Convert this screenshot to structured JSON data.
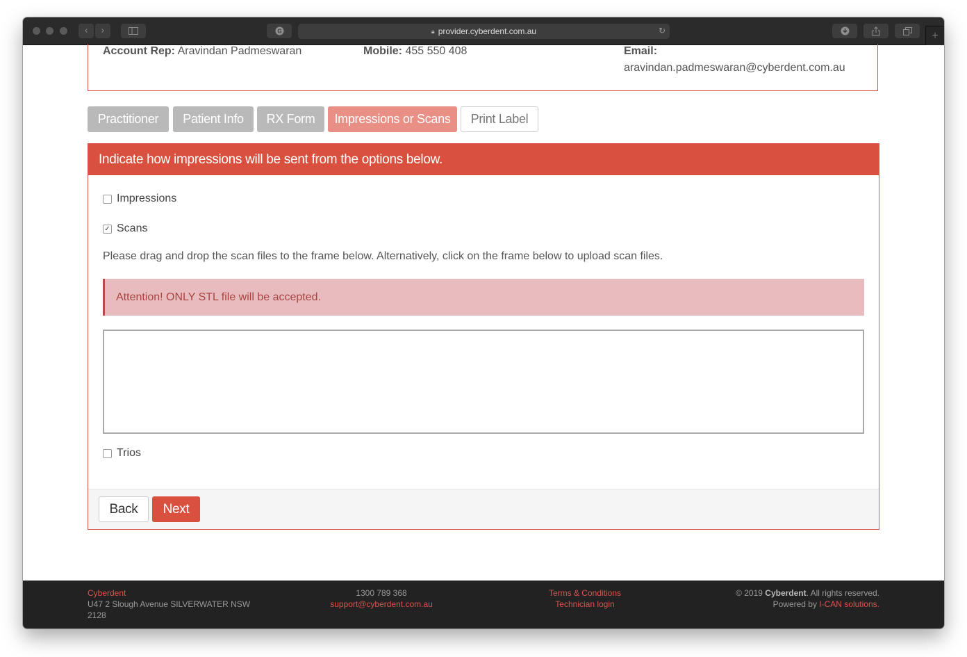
{
  "browser": {
    "url": "provider.cyberdent.com.au",
    "back_icon": "chevron-left",
    "forward_icon": "chevron-right"
  },
  "account": {
    "rep_label": "Account Rep:",
    "rep_name": "Aravindan Padmeswaran",
    "mobile_label": "Mobile:",
    "mobile": "455 550 408",
    "email_label": "Email:",
    "email": "aravindan.padmeswaran@cyberdent.com.au"
  },
  "tabs": [
    {
      "label": "Practitioner",
      "state": "completed"
    },
    {
      "label": "Patient Info",
      "state": "completed"
    },
    {
      "label": "RX Form",
      "state": "completed"
    },
    {
      "label": "Impressions or Scans",
      "state": "active"
    },
    {
      "label": "Print Label",
      "state": "pending"
    }
  ],
  "panel": {
    "heading": "Indicate how impressions will be sent from the options below.",
    "options": [
      {
        "label": "Impressions",
        "checked": false
      },
      {
        "label": "Scans",
        "checked": true
      },
      {
        "label": "Trios",
        "checked": false
      }
    ],
    "instruction": "Please drag and drop the scan files to the frame below. Alternatively, click on the frame below to upload scan files.",
    "alert": "Attention! ONLY STL file will be accepted.",
    "back_label": "Back",
    "next_label": "Next"
  },
  "footer": {
    "company": "Cyberdent",
    "address": "U47 2 Slough Avenue SILVERWATER NSW 2128",
    "phone": "1300 789 368",
    "support_email": "support@cyberdent.com.au",
    "terms": "Terms & Conditions",
    "tech_login": "Technician login",
    "copyright_pre": "© 2019 ",
    "copyright_brand": "Cyberdent",
    "copyright_post": ". All rights reserved.",
    "powered_pre": "Powered by ",
    "powered_link": "I-CAN solutions."
  },
  "colors": {
    "accent": "#d9513e",
    "active_tab": "#e98f86",
    "inactive_tab": "#b9b9b9",
    "alert_bg": "#e8bcbe",
    "alert_text": "#a94442",
    "footer_bg": "#222222"
  }
}
